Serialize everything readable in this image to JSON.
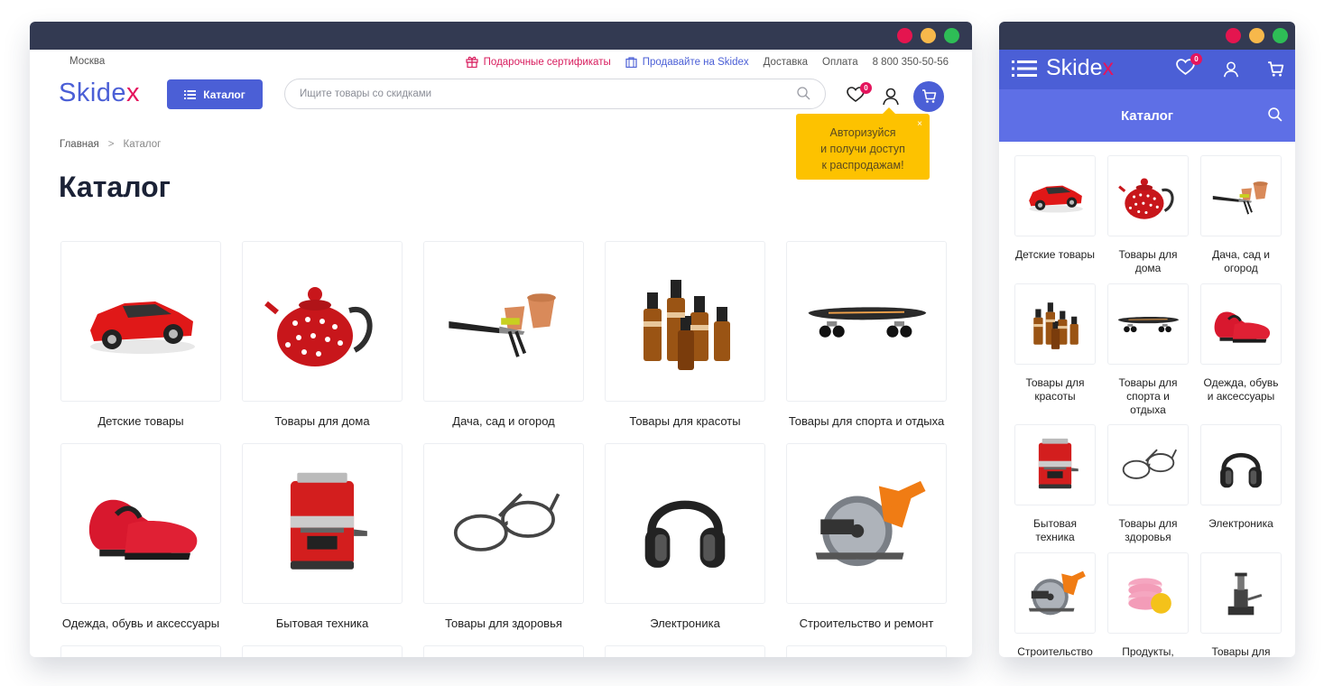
{
  "colors": {
    "brand": "#4b5fd6",
    "accent": "#e4155d",
    "tooltip": "#fdc200",
    "titlebar": "#333a52",
    "dot_red": "#e4154f",
    "dot_yellow": "#f7b84b",
    "dot_green": "#2ebd56"
  },
  "desktop": {
    "city": "Москва",
    "top_links": {
      "gifts": "Подарочные сертификаты",
      "sell": "Продавайте на Skidex",
      "delivery": "Доставка",
      "payment": "Оплата",
      "phone": "8 800 350-50-56"
    },
    "logo": {
      "main": "Skide",
      "tail": "x"
    },
    "catalog_button": "Каталог",
    "search_placeholder": "Ищите товары со скидками",
    "favorites_count": "0",
    "tooltip": {
      "line1": "Авторизуйся",
      "line2": "и получи доступ",
      "line3": "к распродажам!",
      "close": "×"
    },
    "breadcrumb": {
      "home": "Главная",
      "sep": ">",
      "current": "Каталог"
    },
    "page_title": "Каталог",
    "categories": [
      {
        "label": "Детские товары",
        "icon": "toy-car-icon"
      },
      {
        "label": "Товары для дома",
        "icon": "teapot-icon"
      },
      {
        "label": "Дача, сад и огород",
        "icon": "garden-tools-icon"
      },
      {
        "label": "Товары для красоты",
        "icon": "oil-bottles-icon"
      },
      {
        "label": "Товары для спорта и отдыха",
        "icon": "skateboard-icon"
      },
      {
        "label": "Одежда, обувь и аксессуары",
        "icon": "sneakers-icon"
      },
      {
        "label": "Бытовая техника",
        "icon": "coffee-machine-icon"
      },
      {
        "label": "Товары для здоровья",
        "icon": "glasses-icon"
      },
      {
        "label": "Электроника",
        "icon": "headphones-icon"
      },
      {
        "label": "Строительство и ремонт",
        "icon": "circular-saw-icon"
      }
    ]
  },
  "mobile": {
    "logo": {
      "main": "Skide",
      "tail": "x"
    },
    "favorites_count": "0",
    "title": "Каталог",
    "categories": [
      {
        "label": "Детские товары",
        "icon": "toy-car-icon"
      },
      {
        "label": "Товары для дома",
        "icon": "teapot-icon"
      },
      {
        "label": "Дача, сад и огород",
        "icon": "garden-tools-icon"
      },
      {
        "label": "Товары для красоты",
        "icon": "oil-bottles-icon"
      },
      {
        "label": "Товары для спорта и отдыха",
        "icon": "skateboard-icon"
      },
      {
        "label": "Одежда, обувь и аксессуары",
        "icon": "sneakers-icon"
      },
      {
        "label": "Бытовая техника",
        "icon": "coffee-machine-icon"
      },
      {
        "label": "Товары для здоровья",
        "icon": "glasses-icon"
      },
      {
        "label": "Электроника",
        "icon": "headphones-icon"
      },
      {
        "label": "Строительство",
        "icon": "circular-saw-icon"
      },
      {
        "label": "Продукты,",
        "icon": "macarons-icon"
      },
      {
        "label": "Товары для",
        "icon": "car-jack-icon"
      }
    ]
  }
}
